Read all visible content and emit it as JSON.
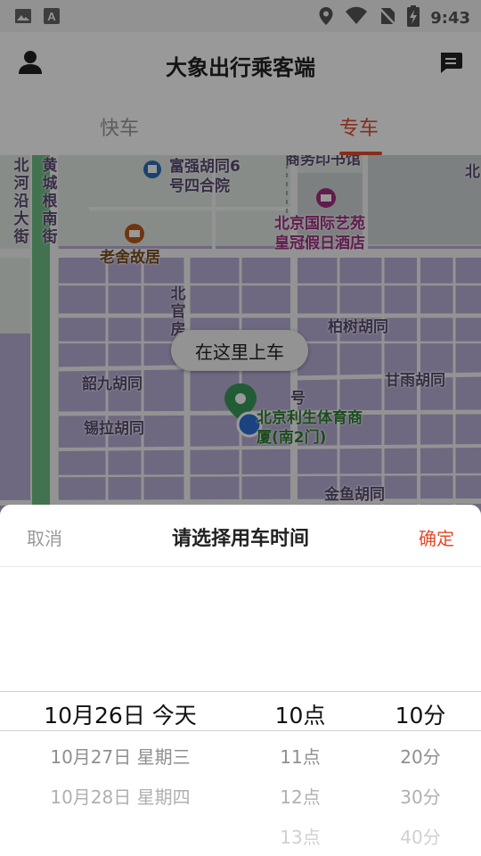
{
  "status_bar": {
    "time": "9:43",
    "icons": [
      "image-icon",
      "a-letter-icon",
      "location-icon",
      "wifi-icon",
      "no-sim-icon",
      "battery-charging-icon"
    ]
  },
  "header": {
    "title": "大象出行乘客端",
    "left_icon": "user-icon",
    "right_icon": "message-icon"
  },
  "tabs": [
    {
      "label": "快车",
      "active": false
    },
    {
      "label": "专车",
      "active": true
    }
  ],
  "map": {
    "labels": [
      "北河沿大街",
      "黄城根南街",
      "富强胡同6号四合院",
      "商务印书馆",
      "北京国际艺苑皇冠假日酒店",
      "老舍故居",
      "北官房",
      "柏树胡同",
      "韶九胡同",
      "甘雨胡同",
      "锡拉胡同",
      "北京利生体育商厦(南2门)",
      "金鱼胡同",
      "北",
      "号"
    ],
    "pickup_callout": "在这里上车"
  },
  "time_picker": {
    "cancel_label": "取消",
    "title": "请选择用车时间",
    "confirm_label": "确定",
    "dates": [
      "10月26日 今天",
      "10月27日 星期三",
      "10月28日 星期四"
    ],
    "hours": [
      "10点",
      "11点",
      "12点",
      "13点"
    ],
    "minutes": [
      "10分",
      "20分",
      "30分",
      "40分"
    ]
  },
  "colors": {
    "accent": "#e24b2b",
    "map_block": "#b9aed7",
    "map_green": "#2e7d32"
  }
}
